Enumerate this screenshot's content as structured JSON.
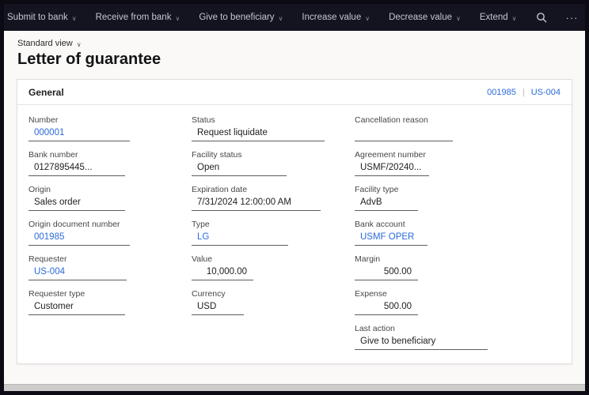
{
  "colors": {
    "accent_link": "#2b6bd7",
    "command_bar_bg": "#141320",
    "content_bg": "#faf9f8",
    "diamond_icon_teal": "#45c0d8",
    "diamond_icon_blue": "#2b7cd3"
  },
  "icons": {
    "chevron_down": "∨",
    "more": "···"
  },
  "command_bar": {
    "buttons": [
      {
        "label": "Submit to bank"
      },
      {
        "label": "Receive from bank"
      },
      {
        "label": "Give to beneficiary"
      },
      {
        "label": "Increase value"
      },
      {
        "label": "Decrease value"
      },
      {
        "label": "Extend"
      }
    ]
  },
  "page": {
    "view_selector": "Standard view",
    "title": "Letter of guarantee"
  },
  "general": {
    "title": "General",
    "ref_links": [
      "001985",
      "US-004"
    ],
    "ref_separator": "|"
  },
  "form": {
    "col1": [
      {
        "label": "Number",
        "value": "000001"
      },
      {
        "label": "Bank number",
        "value": "0127895445..."
      },
      {
        "label": "Origin",
        "value": "Sales order"
      },
      {
        "label": "Origin document number",
        "value": "001985"
      },
      {
        "label": "Requester",
        "value": "US-004"
      },
      {
        "label": "Requester type",
        "value": "Customer"
      }
    ],
    "col2": [
      {
        "label": "Status",
        "value": "Request liquidate"
      },
      {
        "label": "Facility status",
        "value": "Open"
      },
      {
        "label": "Expiration date",
        "value": "7/31/2024 12:00:00 AM"
      },
      {
        "label": "Type",
        "value": "LG"
      },
      {
        "label": "Value",
        "value": "10,000.00"
      },
      {
        "label": "Currency",
        "value": "USD"
      }
    ],
    "col3": [
      {
        "label": "Cancellation reason",
        "value": ""
      },
      {
        "label": "Agreement number",
        "value": "USMF/20240..."
      },
      {
        "label": "Facility type",
        "value": "AdvB"
      },
      {
        "label": "Bank account",
        "value": "USMF OPER"
      },
      {
        "label": "Margin",
        "value": "500.00"
      },
      {
        "label": "Expense",
        "value": "500.00"
      },
      {
        "label": "Last action",
        "value": "Give to beneficiary"
      }
    ]
  }
}
